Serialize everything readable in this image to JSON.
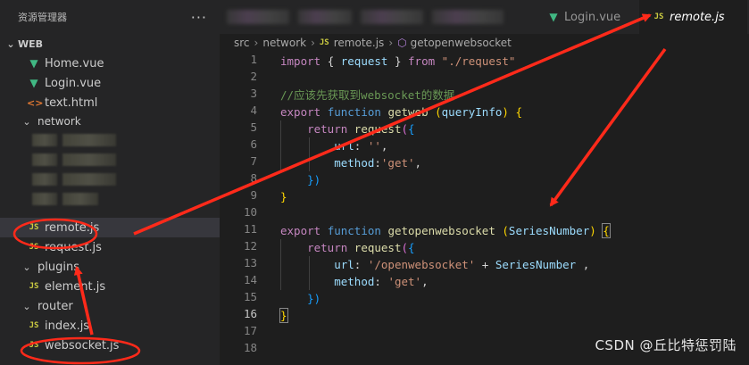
{
  "explorer": {
    "title": "资源管理器",
    "more": "···",
    "root": "WEB",
    "items": [
      {
        "label": "Home.vue",
        "icon": "vue-icon"
      },
      {
        "label": "Login.vue",
        "icon": "vue-icon"
      },
      {
        "label": "text.html",
        "icon": "html-icon"
      },
      {
        "label": "network",
        "icon": "folder"
      },
      {
        "label": "remote.js",
        "icon": "js-icon"
      },
      {
        "label": "request.js",
        "icon": "js-icon"
      },
      {
        "label": "plugins",
        "icon": "folder"
      },
      {
        "label": "element.js",
        "icon": "js-icon"
      },
      {
        "label": "router",
        "icon": "folder"
      },
      {
        "label": "index.js",
        "icon": "js-icon"
      },
      {
        "label": "websocket.js",
        "icon": "js-icon"
      }
    ]
  },
  "tabs": [
    {
      "label": "Login.vue",
      "icon": "vue-icon",
      "active": false
    },
    {
      "label": "remote.js",
      "icon": "js-icon",
      "active": true
    }
  ],
  "breadcrumb": {
    "src": "src",
    "network": "network",
    "file": "remote.js",
    "symbol": "getopenwebsocket"
  },
  "code": {
    "line_numbers": [
      "1",
      "2",
      "3",
      "4",
      "5",
      "6",
      "7",
      "8",
      "9",
      "10",
      "11",
      "12",
      "13",
      "14",
      "15",
      "16",
      "17",
      "18"
    ],
    "current_line": "16",
    "l1": {
      "import": "import",
      "open": "{ ",
      "name": "request",
      "close": " }",
      "from": "from",
      "path": "\"./request\""
    },
    "l3": {
      "comment": "//应该先获取到websocket的数据"
    },
    "l4": {
      "export": "export",
      "function": "function",
      "name": "getweb",
      "open": "(",
      "param": "queryInfo",
      "close": ")",
      "brace": "{"
    },
    "l5": {
      "return": "return",
      "call": "request",
      "paren": "(",
      "brace": "{"
    },
    "l6": {
      "key": "url",
      "colon": ": ",
      "value": "''",
      "comma": ","
    },
    "l7": {
      "key": "method",
      "colon": ":",
      "value": "'get'",
      "comma": ","
    },
    "l8": {
      "close": "})"
    },
    "l9": {
      "close": "}"
    },
    "l11": {
      "export": "export",
      "function": "function",
      "name": "getopenwebsocket",
      "open": "(",
      "param": "SeriesNumber",
      "close": ")",
      "brace": "{"
    },
    "l12": {
      "return": "return",
      "call": "request",
      "paren": "(",
      "brace": "{"
    },
    "l13": {
      "key": "url",
      "colon": ": ",
      "value": "'/openwebsocket'",
      "plus": " + ",
      "var": "SeriesNumber",
      "comma": " ,"
    },
    "l14": {
      "key": "method",
      "colon": ": ",
      "value": "'get'",
      "comma": ","
    },
    "l15": {
      "close": "})"
    },
    "l16": {
      "close": "}"
    }
  },
  "watermark": "CSDN @丘比特惩罚陆",
  "colors": {
    "annotation": "#ff2a1a",
    "vue": "#41b883",
    "js": "#cbcb41"
  }
}
